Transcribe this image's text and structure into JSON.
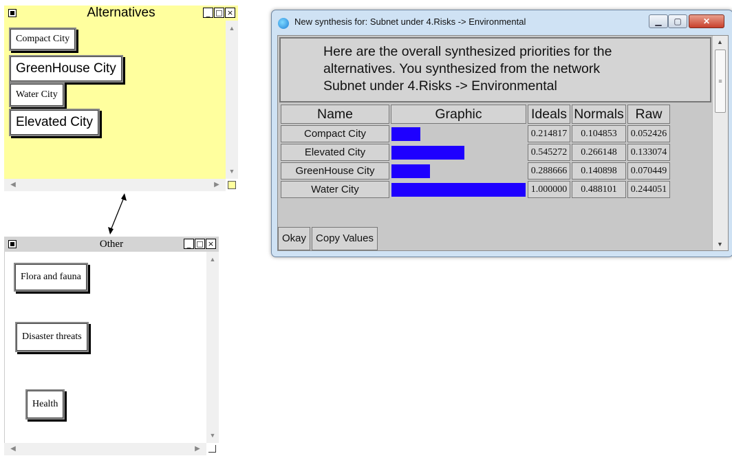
{
  "alternatives_window": {
    "title": "Alternatives",
    "nodes": [
      "Compact City",
      "GreenHouse City",
      "Water City",
      "Elevated City"
    ],
    "background_color": "#ffff9e"
  },
  "other_window": {
    "title": "Other",
    "nodes": [
      "Flora and fauna",
      "Disaster threats",
      "Health"
    ]
  },
  "window_controls": {
    "minimize": "_",
    "restore": "□",
    "close": "×"
  },
  "synthesis_dialog": {
    "title": "New synthesis for: Subnet under 4.Risks -> Environmental",
    "message_lines": [
      "Here are the overall synthesized priorities for the",
      "alternatives.  You synthesized from the network",
      "Subnet under 4.Risks -> Environmental"
    ],
    "columns": [
      "Name",
      "Graphic",
      "Ideals",
      "Normals",
      "Raw"
    ],
    "rows": [
      {
        "name": "Compact City",
        "ideals": "0.214817",
        "normals": "0.104853",
        "raw": "0.052426",
        "graphic": 0.214817
      },
      {
        "name": "Elevated City",
        "ideals": "0.545272",
        "normals": "0.266148",
        "raw": "0.133074",
        "graphic": 0.545272
      },
      {
        "name": "GreenHouse City",
        "ideals": "0.288666",
        "normals": "0.140898",
        "raw": "0.070449",
        "graphic": 0.288666
      },
      {
        "name": "Water City",
        "ideals": "1.000000",
        "normals": "0.488101",
        "raw": "0.244051",
        "graphic": 1.0
      }
    ],
    "buttons": {
      "okay": "Okay",
      "copy_values": "Copy Values"
    },
    "bar_color": "#1e00ff",
    "icons": {
      "app": "refresh-icon",
      "minimize": "minimize-icon",
      "maximize": "maximize-icon",
      "close": "close-icon"
    }
  }
}
